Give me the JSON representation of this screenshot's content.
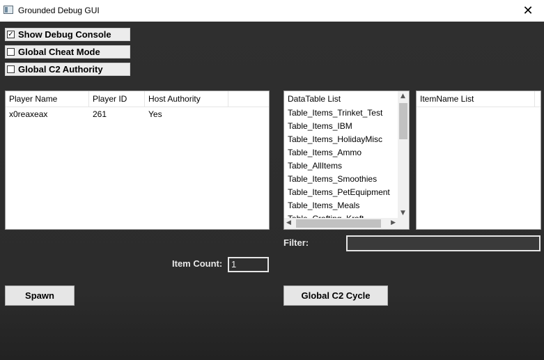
{
  "window": {
    "title": "Grounded Debug GUI",
    "close_glyph": "✕"
  },
  "checkboxes": [
    {
      "label": "Show Debug Console",
      "checked": true
    },
    {
      "label": "Global Cheat Mode",
      "checked": false
    },
    {
      "label": "Global C2 Authority",
      "checked": false
    }
  ],
  "checkmark": "✓",
  "players_table": {
    "columns": [
      "Player Name",
      "Player ID",
      "Host Authority"
    ],
    "rows": [
      [
        "x0reaxeax",
        "261",
        "Yes"
      ]
    ]
  },
  "datatable_list": {
    "header": "DataTable List",
    "items": [
      "Table_Items_Trinket_Test",
      "Table_Items_IBM",
      "Table_Items_HolidayMisc",
      "Table_Items_Ammo",
      "Table_AllItems",
      "Table_Items_Smoothies",
      "Table_Items_PetEquipment",
      "Table_Items_Meals",
      "Table_Crafting_Kraft"
    ]
  },
  "itemname_list": {
    "header": "ItemName List"
  },
  "filter": {
    "label": "Filter:",
    "value": ""
  },
  "item_count": {
    "label": "Item Count:",
    "value": "1"
  },
  "buttons": {
    "spawn": "Spawn",
    "global_c2_cycle": "Global C2 Cycle"
  },
  "icons": {
    "scroll_up": "▲",
    "scroll_down": "▼",
    "scroll_left": "◀",
    "scroll_right": "▶",
    "app": "app-icon"
  }
}
